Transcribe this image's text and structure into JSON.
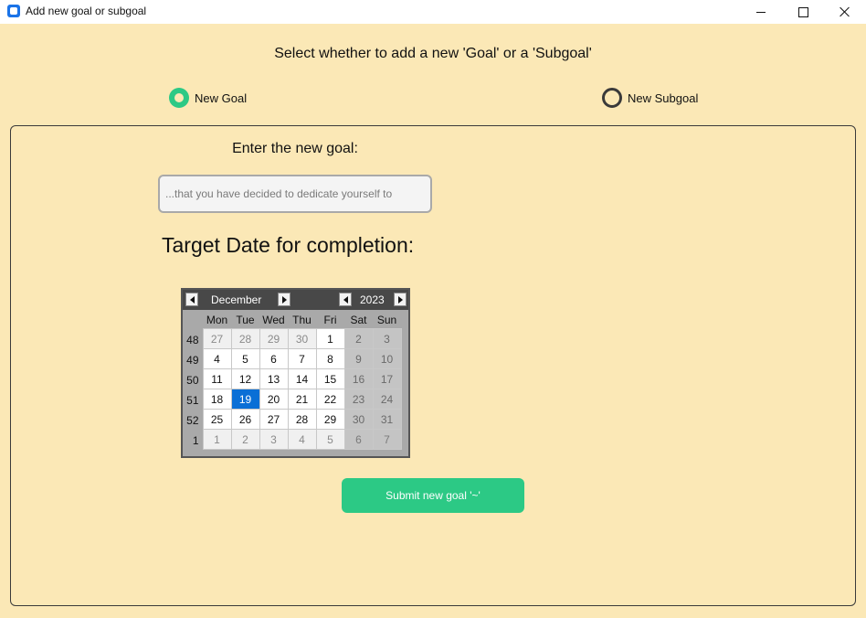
{
  "window": {
    "title": "Add new goal or subgoal"
  },
  "prompt": "Select whether to add a new 'Goal' or a 'Subgoal'",
  "mode": {
    "options": [
      {
        "label": "New Goal",
        "selected": true
      },
      {
        "label": "New Subgoal",
        "selected": false
      }
    ]
  },
  "goal": {
    "label": "Enter the new goal:",
    "placeholder": "...that you have decided to dedicate yourself to",
    "value": ""
  },
  "target_date": {
    "label": "Target Date for completion:"
  },
  "calendar": {
    "month": "December",
    "year": "2023",
    "weekdays": [
      "Mon",
      "Tue",
      "Wed",
      "Thu",
      "Fri",
      "Sat",
      "Sun"
    ],
    "selected_day": "19",
    "weeks": [
      {
        "week": "48",
        "days": [
          "27",
          "28",
          "29",
          "30",
          "1",
          "2",
          "3"
        ]
      },
      {
        "week": "49",
        "days": [
          "4",
          "5",
          "6",
          "7",
          "8",
          "9",
          "10"
        ]
      },
      {
        "week": "50",
        "days": [
          "11",
          "12",
          "13",
          "14",
          "15",
          "16",
          "17"
        ]
      },
      {
        "week": "51",
        "days": [
          "18",
          "19",
          "20",
          "21",
          "22",
          "23",
          "24"
        ]
      },
      {
        "week": "52",
        "days": [
          "25",
          "26",
          "27",
          "28",
          "29",
          "30",
          "31"
        ]
      },
      {
        "week": "1",
        "days": [
          "1",
          "2",
          "3",
          "4",
          "5",
          "6",
          "7"
        ]
      }
    ]
  },
  "submit": {
    "label": "Submit new goal '~'"
  },
  "colors": {
    "background": "#fbe8b6",
    "accent": "#2cc985",
    "selected_date": "#0a6fd6"
  }
}
